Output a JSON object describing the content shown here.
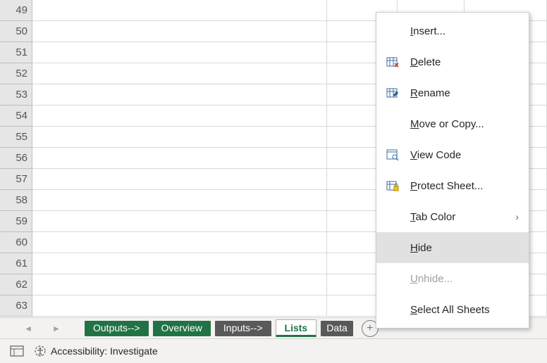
{
  "rows": [
    49,
    50,
    51,
    52,
    53,
    54,
    55,
    56,
    57,
    58,
    59,
    60,
    61,
    62,
    63
  ],
  "tabs": [
    {
      "label": "Outputs-->",
      "kind": "green"
    },
    {
      "label": "Overview",
      "kind": "green"
    },
    {
      "label": "Inputs-->",
      "kind": "dark"
    },
    {
      "label": "Lists",
      "kind": "active"
    },
    {
      "label": "Data",
      "kind": "partial"
    }
  ],
  "newsheet_tooltip": "+",
  "statusbar": {
    "accessibility_label": "Accessibility: Investigate"
  },
  "context_menu": {
    "items": [
      {
        "key": "insert",
        "label_pre": "",
        "u": "I",
        "label_post": "nsert...",
        "icon": "",
        "enabled": true
      },
      {
        "key": "delete",
        "label_pre": "",
        "u": "D",
        "label_post": "elete",
        "icon": "delete",
        "enabled": true
      },
      {
        "key": "rename",
        "label_pre": "",
        "u": "R",
        "label_post": "ename",
        "icon": "rename",
        "enabled": true
      },
      {
        "key": "move",
        "label_pre": "",
        "u": "M",
        "label_post": "ove or Copy...",
        "icon": "",
        "enabled": true
      },
      {
        "key": "viewcode",
        "label_pre": "",
        "u": "V",
        "label_post": "iew Code",
        "icon": "viewcode",
        "enabled": true
      },
      {
        "key": "protect",
        "label_pre": "",
        "u": "P",
        "label_post": "rotect Sheet...",
        "icon": "protect",
        "enabled": true
      },
      {
        "key": "tabcolor",
        "label_pre": "",
        "u": "T",
        "label_post": "ab Color",
        "icon": "",
        "enabled": true,
        "submenu": true
      },
      {
        "key": "hide",
        "label_pre": "",
        "u": "H",
        "label_post": "ide",
        "icon": "",
        "enabled": true,
        "hover": true
      },
      {
        "key": "unhide",
        "label_pre": "",
        "u": "U",
        "label_post": "nhide...",
        "icon": "",
        "enabled": false
      },
      {
        "key": "selectall",
        "label_pre": "",
        "u": "S",
        "label_post": "elect All Sheets",
        "icon": "",
        "enabled": true
      }
    ]
  }
}
